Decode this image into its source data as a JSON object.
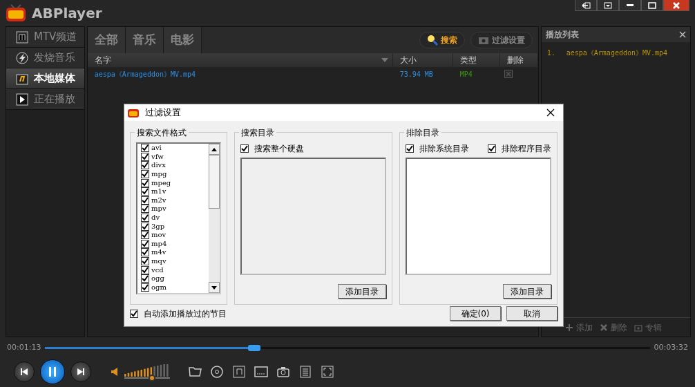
{
  "app": {
    "title": "ABPlayer"
  },
  "sidebar": {
    "items": [
      {
        "label": "MTV频道",
        "selected": false
      },
      {
        "label": "发烧音乐",
        "selected": false
      },
      {
        "label": "本地媒体",
        "selected": true
      },
      {
        "label": "正在播放",
        "selected": false
      }
    ]
  },
  "tabs": [
    "全部",
    "音乐",
    "电影"
  ],
  "toolbar": {
    "search": "搜索",
    "filter": "过滤设置"
  },
  "table": {
    "columns": [
      "名字",
      "大小",
      "类型",
      "删除"
    ],
    "rows": [
      {
        "name": "aespa《Armageddon》MV.mp4",
        "size": "73.94 MB",
        "type": "MP4"
      }
    ]
  },
  "playlist": {
    "title": "播放列表",
    "items": [
      {
        "number": "1.",
        "name": "aespa《Armageddon》MV.mp4"
      }
    ],
    "actions": [
      "添加",
      "删除",
      "专辑"
    ]
  },
  "player": {
    "elapsed": "00:01:13",
    "total": "00:03:32",
    "progress": {
      "level": 0.346
    },
    "volume": {
      "level": 0.6
    }
  },
  "dialog": {
    "title": "过滤设置",
    "formats": {
      "legend": "搜索文件格式",
      "items": [
        {
          "label": "avi",
          "checked": true
        },
        {
          "label": "vfw",
          "checked": true
        },
        {
          "label": "divx",
          "checked": true
        },
        {
          "label": "mpg",
          "checked": true
        },
        {
          "label": "mpeg",
          "checked": true
        },
        {
          "label": "m1v",
          "checked": true
        },
        {
          "label": "m2v",
          "checked": true
        },
        {
          "label": "mpv",
          "checked": true
        },
        {
          "label": "dv",
          "checked": true
        },
        {
          "label": "3gp",
          "checked": true
        },
        {
          "label": "mov",
          "checked": true
        },
        {
          "label": "mp4",
          "checked": true
        },
        {
          "label": "m4v",
          "checked": true
        },
        {
          "label": "mqv",
          "checked": true
        },
        {
          "label": "vcd",
          "checked": true
        },
        {
          "label": "ogg",
          "checked": true
        },
        {
          "label": "ogm",
          "checked": true
        }
      ]
    },
    "search_dirs": {
      "legend": "搜索目录",
      "options": [
        {
          "label": "搜索整个硬盘",
          "checked": true
        }
      ],
      "button": "添加目录"
    },
    "exclude_dirs": {
      "legend": "排除目录",
      "options": [
        {
          "label": "排除系统目录",
          "checked": true
        },
        {
          "label": "排除程序目录",
          "checked": true
        }
      ],
      "button": "添加目录"
    },
    "auto_add": {
      "label": "自动添加播放过的节目",
      "checked": true
    },
    "buttons": [
      "确定(0)",
      "取消"
    ]
  }
}
